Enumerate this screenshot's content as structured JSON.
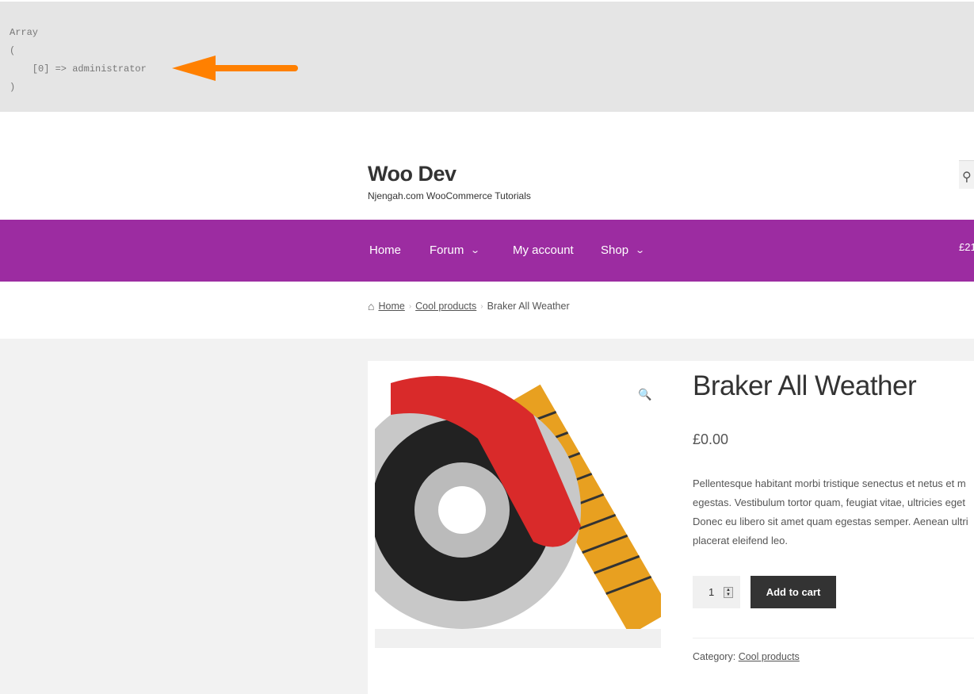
{
  "debug": {
    "lines": [
      "Array",
      "(",
      "    [0] => administrator",
      ")"
    ],
    "arrow_color": "#ff8000"
  },
  "header": {
    "site_title": "Woo Dev",
    "tagline": "Njengah.com WooCommerce Tutorials",
    "search_icon": "search-icon"
  },
  "nav": {
    "items": [
      {
        "label": "Home"
      },
      {
        "label": "Forum",
        "dropdown": true
      },
      {
        "label": "My account"
      },
      {
        "label": "Shop",
        "dropdown": true
      }
    ],
    "cart_total": "£21",
    "bg_color": "#9c2ca1"
  },
  "breadcrumb": {
    "home": "Home",
    "category": "Cool products",
    "current": "Braker All Weather"
  },
  "product": {
    "title": "Braker All Weather",
    "price": "£0.00",
    "description": [
      "Pellentesque habitant morbi tristique senectus et netus et m",
      "egestas. Vestibulum tortor quam, feugiat vitae, ultricies eget",
      "Donec eu libero sit amet quam egestas semper. Aenean ultri",
      "placerat eleifend leo."
    ],
    "quantity": "1",
    "add_to_cart": "Add to cart",
    "category_label": "Category:",
    "category": "Cool products"
  }
}
